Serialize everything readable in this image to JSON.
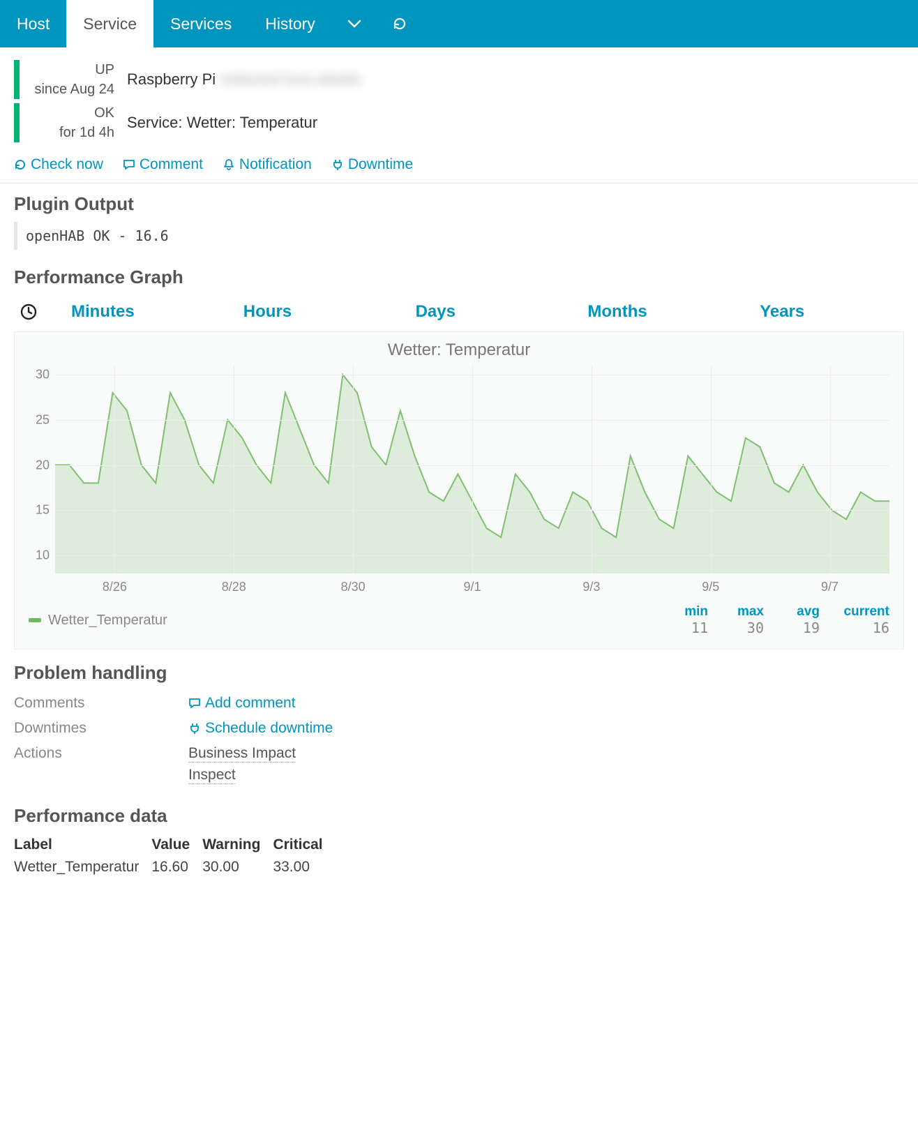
{
  "nav": {
    "tabs": [
      "Host",
      "Service",
      "Services",
      "History"
    ],
    "active_index": 1
  },
  "host_status": {
    "state": "UP",
    "since": "since Aug 24",
    "name": "Raspberry Pi",
    "extra": "redacted host details"
  },
  "service_status": {
    "state": "OK",
    "since": "for 1d 4h",
    "name": "Service: Wetter: Temperatur"
  },
  "actions": {
    "check_now": "Check now",
    "comment": "Comment",
    "notification": "Notification",
    "downtime": "Downtime"
  },
  "plugin_output": {
    "heading": "Plugin Output",
    "text": "openHAB OK - 16.6"
  },
  "perf_graph": {
    "heading": "Performance Graph",
    "ranges": [
      "Minutes",
      "Hours",
      "Days",
      "Months",
      "Years"
    ]
  },
  "chart_data": {
    "type": "area",
    "title": "Wetter: Temperatur",
    "ylabel": "",
    "xlabel": "",
    "ylim": [
      8,
      31
    ],
    "y_ticks": [
      10,
      15,
      20,
      25,
      30
    ],
    "x_labels": [
      "8/26",
      "8/28",
      "8/30",
      "9/1",
      "9/3",
      "9/5",
      "9/7"
    ],
    "series": [
      {
        "name": "Wetter_Temperatur",
        "color": "#7fbf6f",
        "values": [
          20,
          20,
          18,
          18,
          28,
          26,
          20,
          18,
          28,
          25,
          20,
          18,
          25,
          23,
          20,
          18,
          28,
          24,
          20,
          18,
          30,
          28,
          22,
          20,
          26,
          21,
          17,
          16,
          19,
          16,
          13,
          12,
          19,
          17,
          14,
          13,
          17,
          16,
          13,
          12,
          21,
          17,
          14,
          13,
          21,
          19,
          17,
          16,
          23,
          22,
          18,
          17,
          20,
          17,
          15,
          14,
          17,
          16,
          16
        ]
      }
    ],
    "stats_headers": [
      "min",
      "max",
      "avg",
      "current"
    ],
    "stats_values": [
      "11",
      "30",
      "19",
      "16"
    ]
  },
  "problem_handling": {
    "heading": "Problem handling",
    "rows": {
      "comments": {
        "label": "Comments",
        "action": "Add comment"
      },
      "downtimes": {
        "label": "Downtimes",
        "action": "Schedule downtime"
      },
      "actions_label": "Actions",
      "action_links": [
        "Business Impact",
        "Inspect"
      ]
    }
  },
  "performance_data": {
    "heading": "Performance data",
    "columns": [
      "Label",
      "Value",
      "Warning",
      "Critical"
    ],
    "rows": [
      {
        "label": "Wetter_Temperatur",
        "value": "16.60",
        "warning": "30.00",
        "critical": "33.00"
      }
    ]
  }
}
